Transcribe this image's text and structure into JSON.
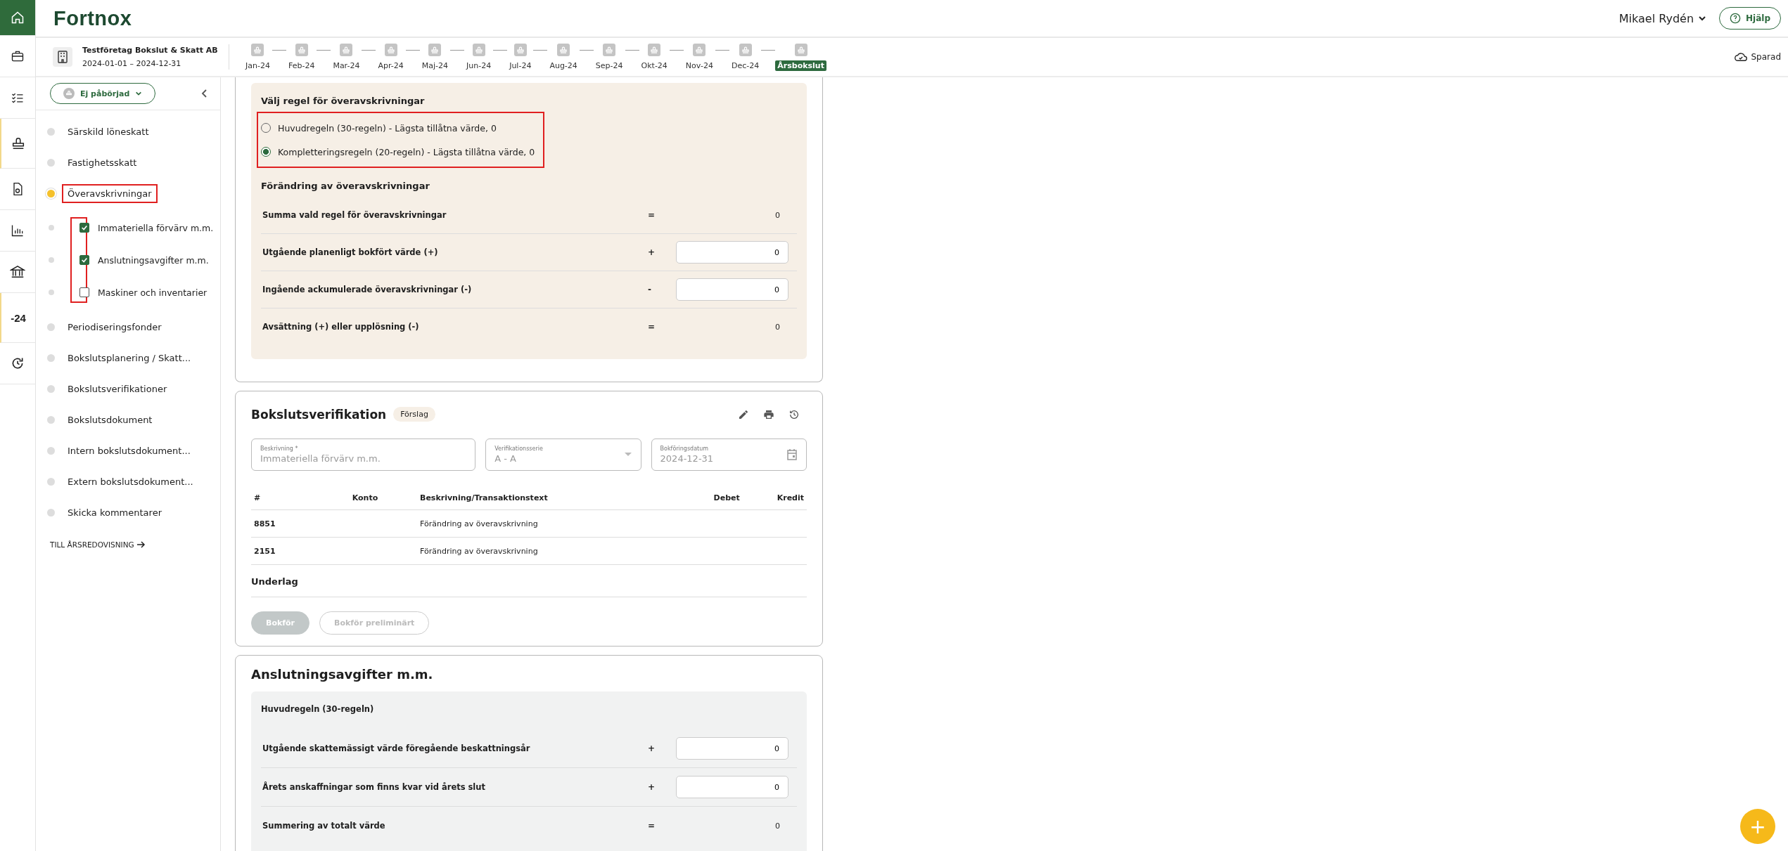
{
  "header": {
    "logo": "Fortnox",
    "user": "Mikael Rydén",
    "help": "Hjälp"
  },
  "rail": [
    {
      "selected": true
    },
    {
      "selected": false
    },
    {
      "selected": false
    },
    {
      "selected": true
    },
    {
      "selected": false
    },
    {
      "selected": false
    },
    {
      "selected": false
    },
    {
      "label": "-24",
      "selected": true
    },
    {
      "selected": false
    }
  ],
  "company": {
    "name": "Testföretag Bokslut & Skatt AB",
    "period": "2024-01-01 – 2024-12-31"
  },
  "timeline": [
    {
      "label": "Jan-24",
      "selected": false
    },
    {
      "label": "Feb-24",
      "selected": false
    },
    {
      "label": "Mar-24",
      "selected": false
    },
    {
      "label": "Apr-24",
      "selected": false
    },
    {
      "label": "Maj-24",
      "selected": false
    },
    {
      "label": "Jun-24",
      "selected": false
    },
    {
      "label": "Jul-24",
      "selected": false
    },
    {
      "label": "Aug-24",
      "selected": false
    },
    {
      "label": "Sep-24",
      "selected": false
    },
    {
      "label": "Okt-24",
      "selected": false
    },
    {
      "label": "Nov-24",
      "selected": false
    },
    {
      "label": "Dec-24",
      "selected": false
    },
    {
      "label": "Årsbokslut",
      "selected": true
    }
  ],
  "save_status": "Sparad",
  "sidebar": {
    "status": "Ej påbörjad",
    "items": [
      {
        "label": "Särskild löneskatt",
        "selected": false,
        "highlighted": false
      },
      {
        "label": "Fastighetsskatt",
        "selected": false,
        "highlighted": false
      },
      {
        "label": "Överavskrivningar",
        "selected": true,
        "highlighted": true,
        "children_highlighted": true,
        "children": [
          {
            "label": "Immateriella förvärv m.m.",
            "checked": true
          },
          {
            "label": "Anslutningsavgifter m.m.",
            "checked": true
          },
          {
            "label": "Maskiner och inventarier",
            "checked": false
          }
        ]
      },
      {
        "label": "Periodiseringsfonder",
        "selected": false,
        "highlighted": false
      },
      {
        "label": "Bokslutsplanering / Skatt...",
        "selected": false,
        "highlighted": false
      },
      {
        "label": "Bokslutsverifikationer",
        "selected": false,
        "highlighted": false
      },
      {
        "label": "Bokslutsdokument",
        "selected": false,
        "highlighted": false
      },
      {
        "label": "Intern bokslutsdokument...",
        "selected": false,
        "highlighted": false
      },
      {
        "label": "Extern bokslutsdokument...",
        "selected": false,
        "highlighted": false
      },
      {
        "label": "Skicka kommentarer",
        "selected": false,
        "highlighted": false
      }
    ],
    "footer_link": "TILL ÅRSREDOVISNING"
  },
  "rule_panel": {
    "title": "Välj regel för överavskrivningar",
    "highlighted": true,
    "options": [
      {
        "label": "Huvudregeln (30-regeln) - Lägsta tillåtna värde, 0",
        "selected": false
      },
      {
        "label": "Kompletteringsregeln (20-regeln) - Lägsta tillåtna värde, 0",
        "selected": true
      }
    ],
    "subtitle": "Förändring av överavskrivningar",
    "rows": [
      {
        "label": "Summa vald regel för överavskrivningar",
        "operator": "=",
        "kind": "static",
        "value": "0"
      },
      {
        "label": "Utgående planenligt bokfört värde (+)",
        "operator": "+",
        "kind": "input",
        "value": "0"
      },
      {
        "label": "Ingående ackumulerade överavskrivningar (-)",
        "operator": "-",
        "kind": "input",
        "value": "0"
      },
      {
        "label": "Avsättning (+) eller upplösning (-)",
        "operator": "=",
        "kind": "static",
        "value": "0"
      }
    ]
  },
  "verification": {
    "title": "Bokslutsverifikation",
    "badge": "Förslag",
    "fields": [
      {
        "kind": "text",
        "label": "Beskrivning *",
        "value": "Immateriella förvärv m.m.",
        "disabled": true
      },
      {
        "kind": "select",
        "label": "Verifikationsserie",
        "value": "A - A",
        "disabled": true
      },
      {
        "kind": "date",
        "label": "Bokföringsdatum",
        "value": "2024-12-31",
        "disabled": true
      }
    ],
    "columns": [
      "#",
      "Konto",
      "Beskrivning/Transaktionstext",
      "Debet",
      "Kredit"
    ],
    "rows": [
      [
        "8851",
        "",
        "Förändring av överavskrivning",
        "",
        ""
      ],
      [
        "2151",
        "",
        "Förändring av överavskrivning",
        "",
        ""
      ]
    ],
    "attachments": "Underlag",
    "buttons": [
      {
        "label": "Bokför",
        "kind": "primary",
        "disabled": true
      },
      {
        "label": "Bokför preliminärt",
        "kind": "secondary",
        "disabled": true
      }
    ]
  },
  "connection": {
    "title": "Anslutningsavgifter m.m.",
    "subtitle": "Huvudregeln (30-regeln)",
    "rows": [
      {
        "label": "Utgående skattemässigt värde föregående beskattningsår",
        "operator": "+",
        "kind": "input",
        "value": "0"
      },
      {
        "label": "Årets anskaffningar som finns kvar vid årets slut",
        "operator": "+",
        "kind": "input",
        "value": "0"
      },
      {
        "label": "Summering av totalt värde",
        "operator": "=",
        "kind": "static",
        "value": "0"
      }
    ]
  },
  "fab": "+"
}
